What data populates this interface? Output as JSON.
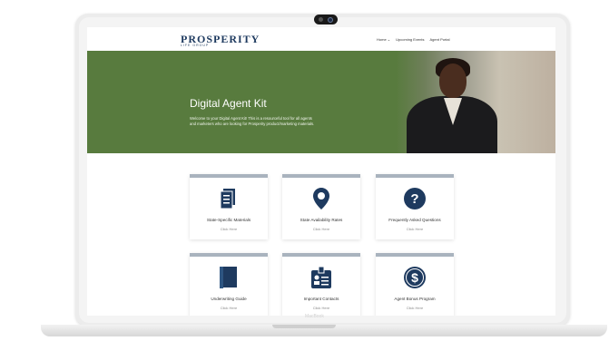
{
  "header": {
    "logo_text": "PROSPERITY",
    "logo_sub": "LIFE GROUP",
    "nav": [
      "Home ⌄",
      "Upcoming Events",
      "Agent Portal"
    ]
  },
  "hero": {
    "title": "Digital Agent Kit",
    "text": "Welcome to your Digital Agent Kit! This is a resourceful tool for all agents and marketers who are looking for Prosperity product/marketing materials."
  },
  "cards": [
    {
      "title": "State-Specific Materials",
      "link": "Click Here",
      "icon": "document-icon"
    },
    {
      "title": "State Availability Rates",
      "link": "Click Here",
      "icon": "location-pin-icon"
    },
    {
      "title": "Frequently Asked Questions",
      "link": "Click Here",
      "icon": "question-icon"
    },
    {
      "title": "Underwriting Guide",
      "link": "Click Here",
      "icon": "book-icon"
    },
    {
      "title": "Important Contacts",
      "link": "Click Here",
      "icon": "contact-badge-icon"
    },
    {
      "title": "Agent Bonus Program",
      "link": "Click Here",
      "icon": "dollar-icon"
    }
  ],
  "colors": {
    "hero_green": "#587b3e",
    "icon_navy": "#1e3a5f",
    "card_top": "#a9b3be"
  },
  "device": {
    "brand": "MacBook"
  }
}
